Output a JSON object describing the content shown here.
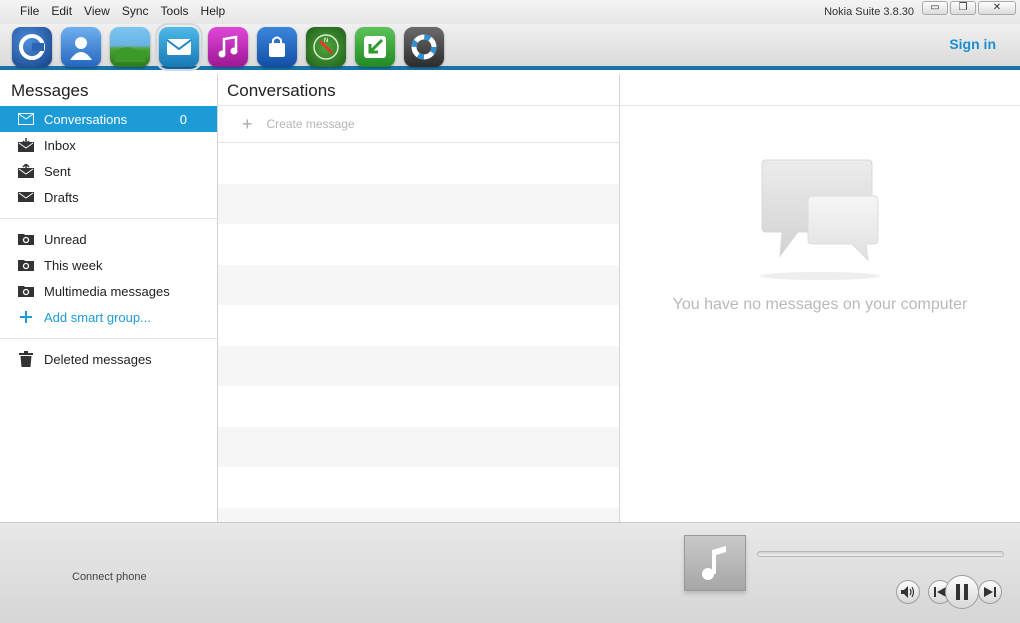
{
  "menu": {
    "items": [
      "File",
      "Edit",
      "View",
      "Sync",
      "Tools",
      "Help"
    ]
  },
  "app": {
    "title": "Nokia Suite 3.8.30"
  },
  "window_controls": {
    "minimize": "▭",
    "restore": "❐",
    "close": "✕"
  },
  "toolbar": {
    "icons": [
      {
        "name": "nokia-home-icon",
        "color": "#1f5ea8"
      },
      {
        "name": "contacts-icon",
        "color": "#3a83d2"
      },
      {
        "name": "photos-icon",
        "color": "#3d8e2d"
      },
      {
        "name": "messages-icon",
        "color": "#1d9bd6"
      },
      {
        "name": "music-icon",
        "color": "#c225b8"
      },
      {
        "name": "store-icon",
        "color": "#1b5db8"
      },
      {
        "name": "maps-icon",
        "color": "#2e7d2a"
      },
      {
        "name": "update-icon",
        "color": "#3aa335"
      },
      {
        "name": "support-icon",
        "color": "#444"
      }
    ],
    "signin": "Sign in"
  },
  "left": {
    "title": "Messages",
    "folders": [
      {
        "label": "Conversations",
        "count": "0",
        "icon": "conversations-icon"
      },
      {
        "label": "Inbox",
        "icon": "inbox-icon"
      },
      {
        "label": "Sent",
        "icon": "sent-icon"
      },
      {
        "label": "Drafts",
        "icon": "drafts-icon"
      }
    ],
    "groups": [
      {
        "label": "Unread",
        "icon": "smart-folder-icon"
      },
      {
        "label": "This week",
        "icon": "smart-folder-icon"
      },
      {
        "label": "Multimedia messages",
        "icon": "smart-folder-icon"
      },
      {
        "label": "Add smart group...",
        "icon": "plus-icon"
      }
    ],
    "deleted": {
      "label": "Deleted messages",
      "icon": "trash-icon"
    }
  },
  "middle": {
    "title": "Conversations",
    "create": "Create message"
  },
  "right": {
    "empty_text": "You have no messages on your computer"
  },
  "bottom": {
    "connect": "Connect phone",
    "progress": 0
  },
  "colors": {
    "accent": "#1d9bd6",
    "toolbar_border": "#1773a8"
  }
}
